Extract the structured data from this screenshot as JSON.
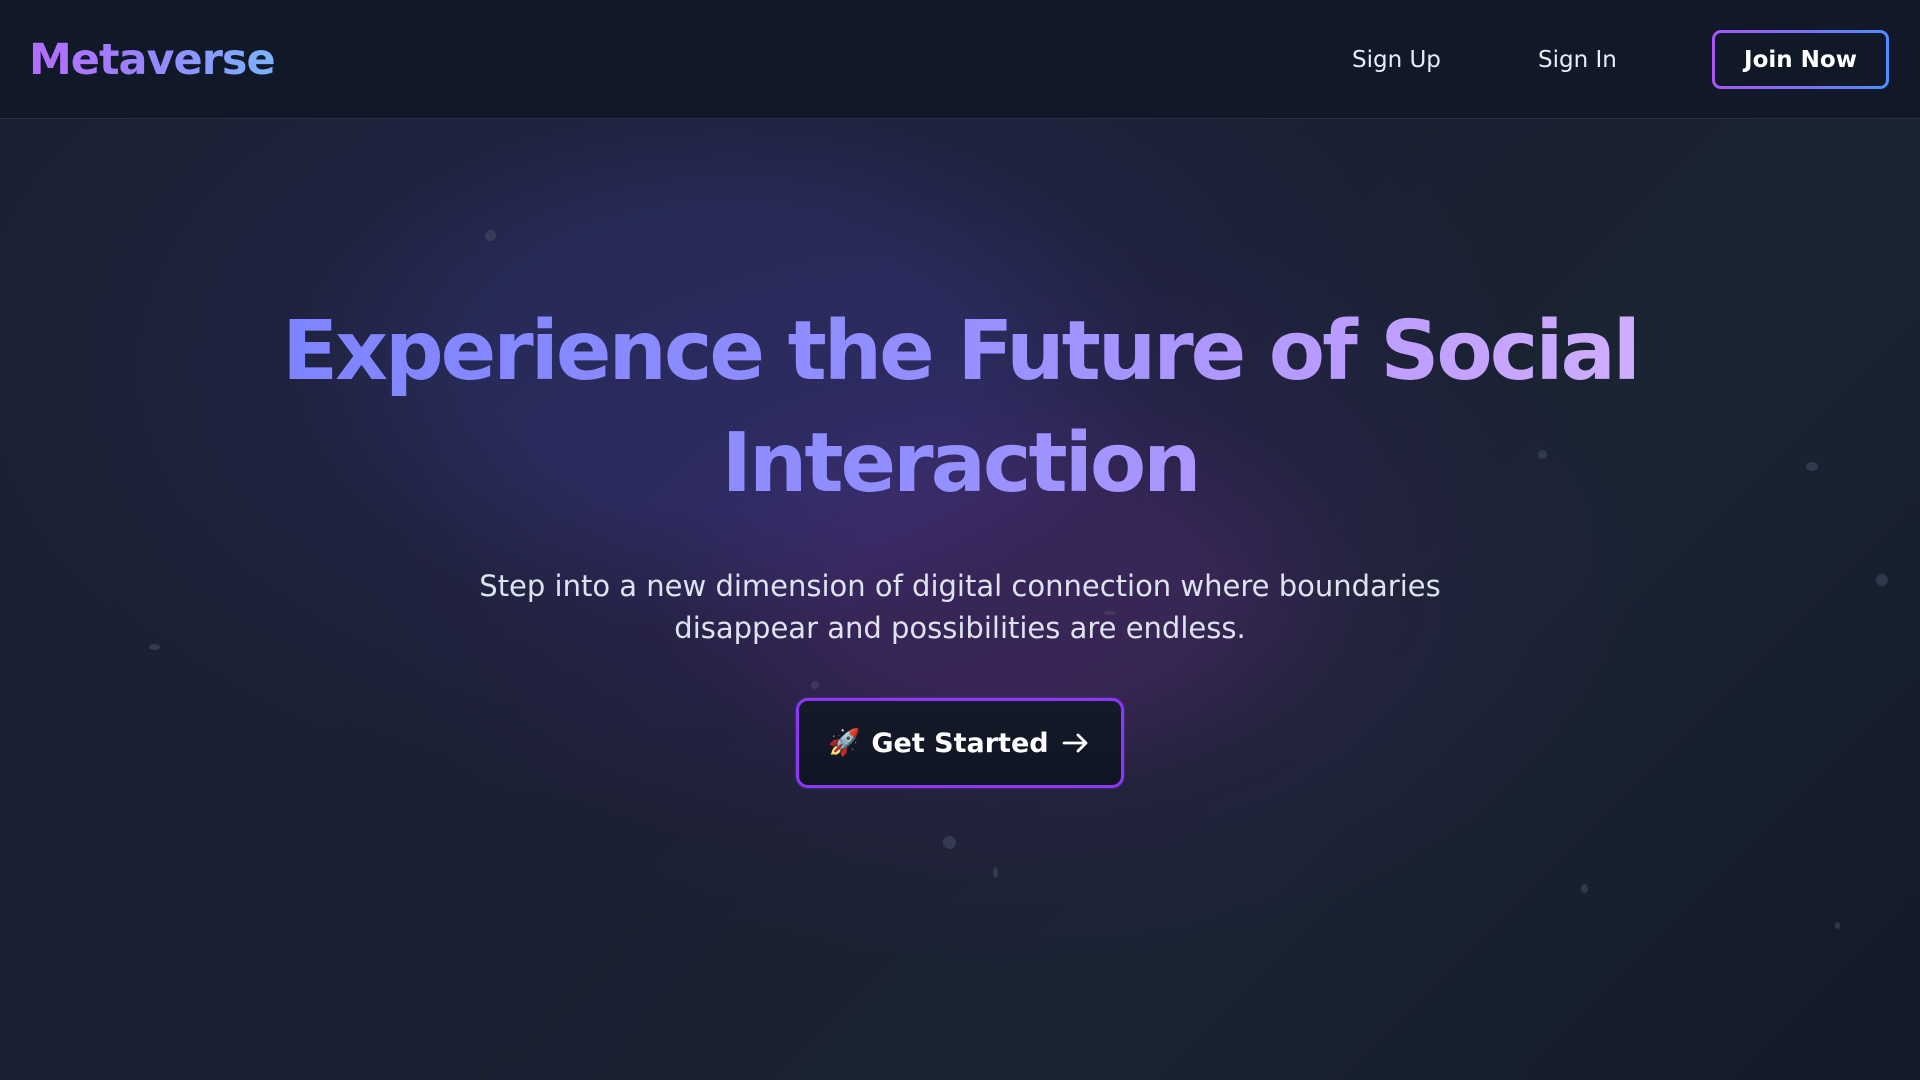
{
  "app": {
    "brand": "Metaverse"
  },
  "navigation": {
    "links": [
      {
        "label": "Sign Up"
      },
      {
        "label": "Sign In"
      }
    ],
    "join_button": "Join Now"
  },
  "hero": {
    "title_line_1": "Experience the Future of Social",
    "title_line_2": "Interaction",
    "subtitle_line_1": "Step into a new dimension of digital connection where boundaries",
    "subtitle_line_2": "disappear and possibilities are endless.",
    "cta": {
      "emoji": "🚀",
      "label": "Get Started",
      "icon": "arrow-right-icon"
    }
  },
  "colors": {
    "brand_purple": "#a855f7",
    "brand_blue": "#4f8cff",
    "background": "#171d2b",
    "nav_background": "#111827",
    "cta_border": "#8b38f5"
  }
}
